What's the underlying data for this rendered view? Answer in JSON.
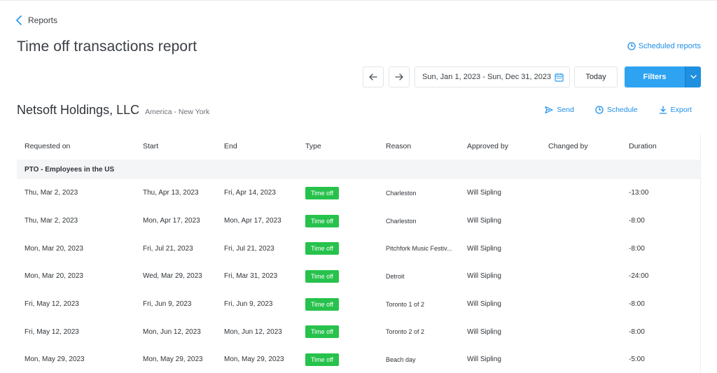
{
  "breadcrumb": {
    "label": "Reports"
  },
  "page": {
    "title": "Time off transactions report"
  },
  "header": {
    "scheduled_reports": "Scheduled reports",
    "date_range": "Sun, Jan 1, 2023 - Sun, Dec 31, 2023",
    "today": "Today",
    "filters": "Filters"
  },
  "company": {
    "name": "Netsoft Holdings, LLC",
    "timezone": "America - New York"
  },
  "actions": {
    "send": "Send",
    "schedule": "Schedule",
    "export": "Export"
  },
  "colors": {
    "accent": "#2ea3f2",
    "badge": "#27c24c"
  },
  "table": {
    "columns": [
      "Requested on",
      "Start",
      "End",
      "Type",
      "Reason",
      "Approved by",
      "Changed by",
      "Duration"
    ],
    "group": "PTO - Employees in the US",
    "rows": [
      {
        "requested": "Thu, Mar 2, 2023",
        "start": "Thu, Apr 13, 2023",
        "end": "Fri, Apr 14, 2023",
        "type": "Time off",
        "reason": "Charleston",
        "approved": "Will Sipling",
        "changed": "",
        "duration": "-13:00"
      },
      {
        "requested": "Thu, Mar 2, 2023",
        "start": "Mon, Apr 17, 2023",
        "end": "Mon, Apr 17, 2023",
        "type": "Time off",
        "reason": "Charleston",
        "approved": "Will Sipling",
        "changed": "",
        "duration": "-8:00"
      },
      {
        "requested": "Mon, Mar 20, 2023",
        "start": "Fri, Jul 21, 2023",
        "end": "Fri, Jul 21, 2023",
        "type": "Time off",
        "reason": "Pitchfork Music Festiv...",
        "approved": "Will Sipling",
        "changed": "",
        "duration": "-8:00"
      },
      {
        "requested": "Mon, Mar 20, 2023",
        "start": "Wed, Mar 29, 2023",
        "end": "Fri, Mar 31, 2023",
        "type": "Time off",
        "reason": "Detroit",
        "approved": "Will Sipling",
        "changed": "",
        "duration": "-24:00"
      },
      {
        "requested": "Fri, May 12, 2023",
        "start": "Fri, Jun 9, 2023",
        "end": "Fri, Jun 9, 2023",
        "type": "Time off",
        "reason": "Toronto 1 of 2",
        "approved": "Will Sipling",
        "changed": "",
        "duration": "-8:00"
      },
      {
        "requested": "Fri, May 12, 2023",
        "start": "Mon, Jun 12, 2023",
        "end": "Mon, Jun 12, 2023",
        "type": "Time off",
        "reason": "Toronto 2 of 2",
        "approved": "Will Sipling",
        "changed": "",
        "duration": "-8:00"
      },
      {
        "requested": "Mon, May 29, 2023",
        "start": "Mon, May 29, 2023",
        "end": "Mon, May 29, 2023",
        "type": "Time off",
        "reason": "Beach day",
        "approved": "Will Sipling",
        "changed": "",
        "duration": "-5:00"
      }
    ]
  }
}
